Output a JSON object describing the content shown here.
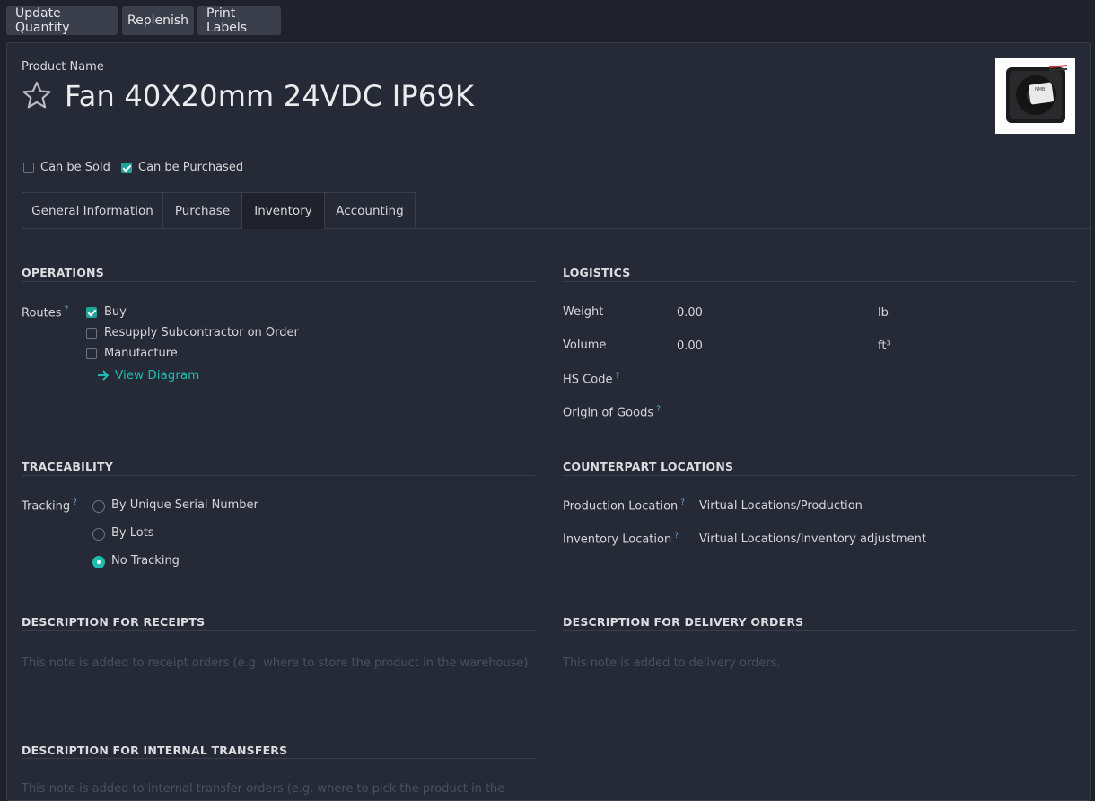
{
  "toolbar": {
    "update_quantity": "Update Quantity",
    "replenish": "Replenish",
    "print_labels": "Print Labels"
  },
  "product": {
    "name_label": "Product Name",
    "name": "Fan 40X20mm 24VDC IP69K",
    "image_text": "NMB",
    "can_be_sold": {
      "label": "Can be Sold",
      "checked": false
    },
    "can_be_purchased": {
      "label": "Can be Purchased",
      "checked": true
    }
  },
  "tabs": [
    {
      "label": "General Information"
    },
    {
      "label": "Purchase"
    },
    {
      "label": "Inventory",
      "active": true
    },
    {
      "label": "Accounting"
    }
  ],
  "operations": {
    "title": "OPERATIONS",
    "routes_label": "Routes",
    "routes": [
      {
        "label": "Buy",
        "checked": true
      },
      {
        "label": "Resupply Subcontractor on Order",
        "checked": false
      },
      {
        "label": "Manufacture",
        "checked": false
      }
    ],
    "view_diagram": "View Diagram"
  },
  "logistics": {
    "title": "LOGISTICS",
    "weight_label": "Weight",
    "weight_value": "0.00",
    "weight_unit": "lb",
    "volume_label": "Volume",
    "volume_value": "0.00",
    "volume_unit": "ft³",
    "hs_code_label": "HS Code",
    "origin_label": "Origin of Goods"
  },
  "traceability": {
    "title": "TRACEABILITY",
    "tracking_label": "Tracking",
    "options": [
      {
        "label": "By Unique Serial Number",
        "selected": false
      },
      {
        "label": "By Lots",
        "selected": false
      },
      {
        "label": "No Tracking",
        "selected": true
      }
    ]
  },
  "counterpart": {
    "title": "COUNTERPART LOCATIONS",
    "production_label": "Production Location",
    "production_value": "Virtual Locations/Production",
    "inventory_label": "Inventory Location",
    "inventory_value": "Virtual Locations/Inventory adjustment"
  },
  "receipts": {
    "title": "DESCRIPTION FOR RECEIPTS",
    "placeholder": "This note is added to receipt orders (e.g. where to store the product in the warehouse)."
  },
  "delivery": {
    "title": "DESCRIPTION FOR DELIVERY ORDERS",
    "placeholder": "This note is added to delivery orders."
  },
  "internal": {
    "title": "DESCRIPTION FOR INTERNAL TRANSFERS",
    "placeholder": "This note is added to internal transfer orders (e.g. where to pick the product in the"
  },
  "help_mark": "?",
  "colors": {
    "background": "#1f222b",
    "sheet": "#262a36",
    "accent": "#1fbcb0",
    "button": "#3b3f4c"
  }
}
